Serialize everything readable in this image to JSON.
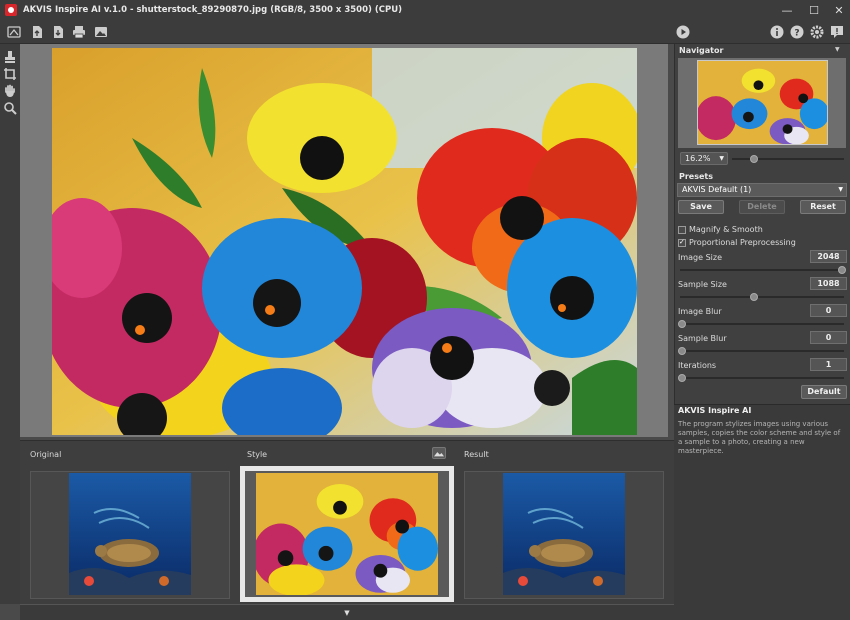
{
  "window": {
    "title": "AKVIS Inspire AI v.1.0 - shutterstock_89290870.jpg (RGB/8, 3500 x 3500) (CPU)",
    "minimize": "—",
    "maximize": "☐",
    "close": "✕"
  },
  "toolbar": {
    "buttons": [
      "home-icon",
      "open-icon",
      "save-icon",
      "print-icon",
      "style-gallery-icon",
      "run-icon",
      "info-icon",
      "help-icon",
      "settings-icon",
      "feedback-icon"
    ]
  },
  "tools": [
    "brush-tool-icon",
    "crop-icon",
    "hand-icon",
    "zoom-icon"
  ],
  "bottom": {
    "original_label": "Original",
    "style_label": "Style",
    "result_label": "Result",
    "collapse_glyph": "▼"
  },
  "navigator": {
    "title": "Navigator",
    "zoom": "16.2%",
    "zoom_arrow": "▼"
  },
  "presets": {
    "title": "Presets",
    "selected": "AKVIS Default (1)",
    "arrow": "▼",
    "save": "Save",
    "delete": "Delete",
    "reset": "Reset"
  },
  "options": {
    "magnify_smooth": "Magnify & Smooth",
    "magnify_smooth_checked": false,
    "proportional": "Proportional Preprocessing",
    "proportional_checked": true
  },
  "params": [
    {
      "label": "Image Size",
      "value": "2048",
      "level": 1.0
    },
    {
      "label": "Sample Size",
      "value": "1088",
      "level": 0.45
    },
    {
      "label": "Image Blur",
      "value": "0",
      "level": 0.0
    },
    {
      "label": "Sample Blur",
      "value": "0",
      "level": 0.0
    },
    {
      "label": "Iterations",
      "value": "1",
      "level": 0.0
    }
  ],
  "default_button": "Default",
  "info": {
    "title": "AKVIS Inspire AI",
    "text": "The program stylizes images using various samples, copies the color scheme and style of a sample to a photo, creating a new masterpiece."
  },
  "colors": {
    "accent_bg": "#3c3c3c",
    "panel_bg": "#404040",
    "canvas_bg": "#7a7a7a"
  }
}
